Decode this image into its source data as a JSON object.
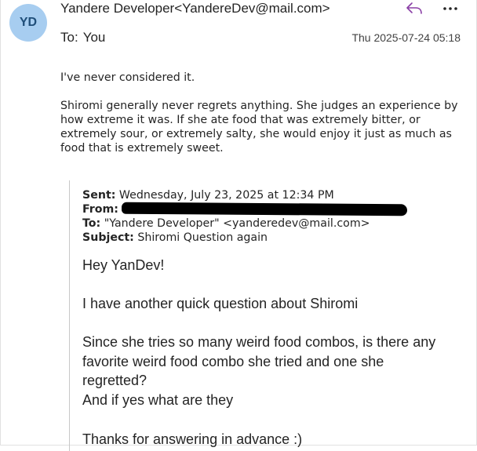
{
  "header": {
    "avatar_initials": "YD",
    "sender": "Yandere Developer<YandereDev@mail.com>",
    "to_label": "To:",
    "to_value": "You",
    "date": "Thu 2025-07-24 05:18",
    "reply_icon": "reply-icon",
    "more_icon": "more-icon"
  },
  "reply_body": {
    "p1": "I've never considered it.",
    "p2": "Shiromi generally never regrets anything. She judges an experience by how extreme it was. If she ate food that was extremely bitter, or extremely sour, or extremely salty, she would enjoy it just as much as food that is extremely sweet."
  },
  "quoted": {
    "sent_label": "Sent:",
    "sent_value": "Wednesday, July 23, 2025 at 12:34 PM",
    "from_label": "From:",
    "to_label": "To:",
    "to_value": "\"Yandere Developer\" <yanderedev@mail.com>",
    "subject_label": "Subject:",
    "subject_value": "Shiromi Question again",
    "body": [
      "Hey YanDev!",
      "I have another quick question about Shiromi",
      "Since she tries so many weird food combos, is there any favorite weird food combo she tried and one she regretted?",
      "And if yes what are they",
      "Thanks for answering in advance :)"
    ]
  },
  "colors": {
    "avatar_bg": "#a7cdf0",
    "avatar_text": "#1f4e79",
    "reply_icon": "#8a3fa6",
    "redaction": "#000000"
  }
}
